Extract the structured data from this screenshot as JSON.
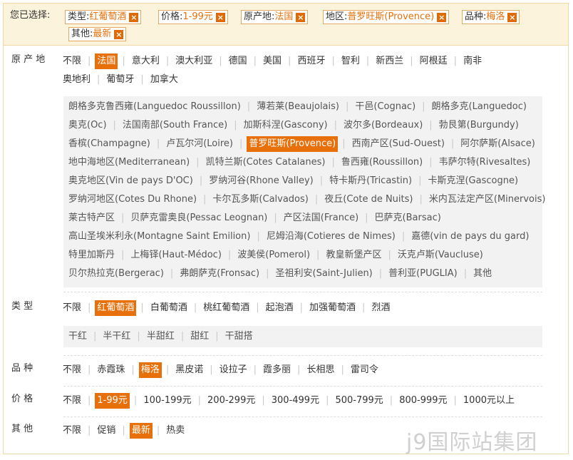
{
  "selected": {
    "label": "您已选择:",
    "chips": [
      {
        "key": "类型:",
        "value": "红葡萄酒"
      },
      {
        "key": "价格:",
        "value": "1-99元"
      },
      {
        "key": "原产地:",
        "value": "法国"
      },
      {
        "key": "地区:",
        "value": "普罗旺斯(Provence)"
      },
      {
        "key": "品种:",
        "value": "梅洛"
      },
      {
        "key": "其他:",
        "value": "最新"
      }
    ],
    "remove_icon": "×"
  },
  "filters": {
    "origin": {
      "label": "原 产 地",
      "row1": [
        "不限",
        "法国",
        "意大利",
        "澳大利亚",
        "德国",
        "美国",
        "西班牙",
        "智利",
        "新西兰",
        "阿根廷",
        "南非"
      ],
      "row2": [
        "奥地利",
        "葡萄牙",
        "加拿大"
      ],
      "selected": "法国"
    },
    "region": {
      "rows": [
        [
          "朗格多克鲁西雍(Languedoc Roussillon)",
          "薄若莱(Beaujolais)",
          "干邑(Cognac)",
          "朗格多克(Languedoc)"
        ],
        [
          "奥克(Oc)",
          "法国南部(South France)",
          "加斯科涅(Gascony)",
          "波尔多(Bordeaux)",
          "勃艮第(Burgundy)"
        ],
        [
          "香槟(Champagne)",
          "卢瓦尔河(Loire)",
          "普罗旺斯(Provence)",
          "西南产区(Sud-Ouest)",
          "阿尔萨斯(Alsace)"
        ],
        [
          "地中海地区(Mediterranean)",
          "凯特兰斯(Cotes Catalanes)",
          "鲁西雍(Roussillon)",
          "韦萨尔特(Rivesaltes)"
        ],
        [
          "奥克地区(Vin de pays D'OC)",
          "罗纳河谷(Rhone Valley)",
          "特卡斯丹(Tricastin)",
          "卡斯克涅(Gascogne)"
        ],
        [
          "罗纳河地区(Cotes Du Rhone)",
          "卡尔瓦多斯(Calvados)",
          "夜丘(Cote de Nuits)",
          "米内瓦法定产区(Minervois)"
        ],
        [
          "莱古特产区",
          "贝萨克雷奥良(Pessac Leognan)",
          "产区法国(France)",
          "巴萨克(Barsac)"
        ],
        [
          "高山圣埃米利永(Montagne Saint Emilion)",
          "尼姆沿海(Cotieres de Nimes)",
          "嘉德(vin de pays du gard)"
        ],
        [
          "特里加斯丹",
          "上梅铎(Haut-Médoc)",
          "波美侯(Pomerol)",
          "教皇新堡产区",
          "沃克卢斯(Vaucluse)"
        ],
        [
          "贝尔热拉克(Bergerac)",
          "弗朗萨克(Fronsac)",
          "圣祖利安(Saint-Julien)",
          "普利亚(PUGLIA)",
          "其他"
        ]
      ],
      "selected": "普罗旺斯(Provence)"
    },
    "type": {
      "label": "类 型",
      "options": [
        "不限",
        "红葡萄酒",
        "白葡萄酒",
        "桃红葡萄酒",
        "起泡酒",
        "加强葡萄酒",
        "烈酒"
      ],
      "sub": [
        "干红",
        "半干红",
        "半甜红",
        "甜红",
        "干甜搭"
      ],
      "selected": "红葡萄酒"
    },
    "variety": {
      "label": "品 种",
      "options": [
        "不限",
        "赤霞珠",
        "梅洛",
        "黑皮诺",
        "设拉子",
        "霞多丽",
        "长相思",
        "雷司令"
      ],
      "selected": "梅洛"
    },
    "price": {
      "label": "价 格",
      "options": [
        "不限",
        "1-99元",
        "100-199元",
        "200-299元",
        "300-499元",
        "500-799元",
        "800-999元",
        "1000元以上"
      ],
      "selected": "1-99元"
    },
    "other": {
      "label": "其 他",
      "options": [
        "不限",
        "促销",
        "最新",
        "热卖"
      ],
      "selected": "最新"
    }
  },
  "watermark": "j9国际站集团"
}
